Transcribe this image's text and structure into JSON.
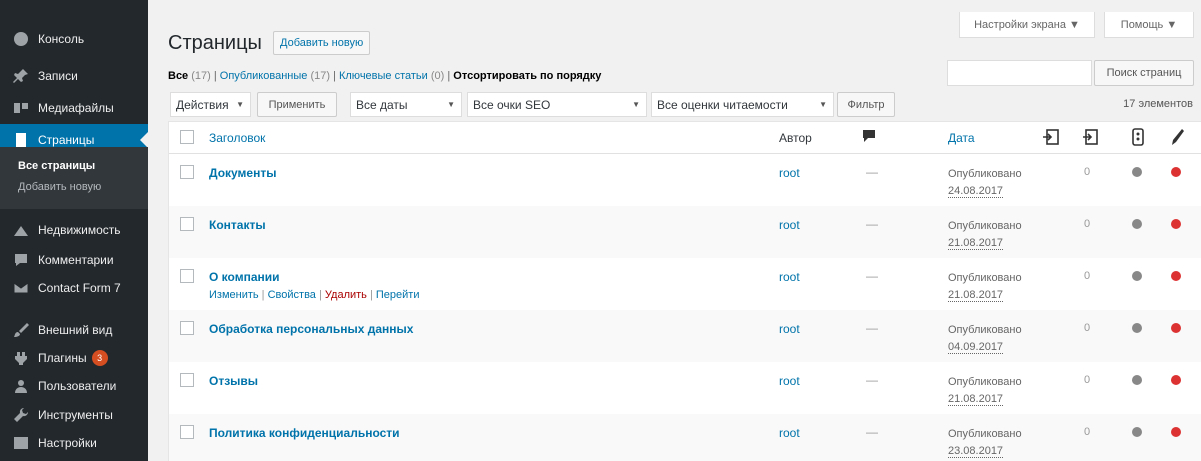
{
  "sidebar": {
    "items": [
      {
        "label": "Консоль",
        "icon": "dashboard-icon"
      },
      {
        "label": "Записи",
        "icon": "pin-icon"
      },
      {
        "label": "Медиафайлы",
        "icon": "media-icon"
      },
      {
        "label": "Страницы",
        "icon": "pages-icon"
      },
      {
        "label": "Недвижимость",
        "icon": "building-icon"
      },
      {
        "label": "Комментарии",
        "icon": "comment-icon"
      },
      {
        "label": "Contact Form 7",
        "icon": "mail-icon"
      },
      {
        "label": "Внешний вид",
        "icon": "brush-icon"
      },
      {
        "label": "Плагины",
        "icon": "plugin-icon",
        "badge": "3"
      },
      {
        "label": "Пользователи",
        "icon": "users-icon"
      },
      {
        "label": "Инструменты",
        "icon": "wrench-icon"
      },
      {
        "label": "Настройки",
        "icon": "settings-icon"
      }
    ],
    "submenu": {
      "all": "Все страницы",
      "add": "Добавить новую"
    }
  },
  "top": {
    "screen_options": "Настройки экрана ▼",
    "help": "Помощь ▼"
  },
  "header": {
    "title": "Страницы",
    "add_new": "Добавить новую"
  },
  "views": {
    "all": "Все",
    "all_count": "(17)",
    "published": "Опубликованные",
    "published_count": "(17)",
    "key": "Ключевые статьи",
    "key_count": "(0)",
    "sort": "Отсортировать по порядку"
  },
  "search": {
    "value": "",
    "button": "Поиск страниц"
  },
  "filters": {
    "bulk": "Действия",
    "apply": "Применить",
    "dates": "Все даты",
    "seo": "Все очки SEO",
    "readability": "Все оценки читаемости",
    "filter": "Фильтр",
    "count": "17 элементов"
  },
  "table": {
    "headers": {
      "title": "Заголовок",
      "author": "Автор",
      "date": "Дата"
    },
    "rows": [
      {
        "title": "Документы",
        "author": "root",
        "comments": "—",
        "status": "Опубликовано",
        "date": "24.08.2017",
        "links": "0"
      },
      {
        "title": "Контакты",
        "author": "root",
        "comments": "—",
        "status": "Опубликовано",
        "date": "21.08.2017",
        "links": "0"
      },
      {
        "title": "О компании",
        "author": "root",
        "comments": "—",
        "status": "Опубликовано",
        "date": "21.08.2017",
        "links": "0",
        "actions": {
          "edit": "Изменить",
          "props": "Свойства",
          "delete": "Удалить",
          "view": "Перейти"
        }
      },
      {
        "title": "Обработка персональных данных",
        "author": "root",
        "comments": "—",
        "status": "Опубликовано",
        "date": "04.09.2017",
        "links": "0"
      },
      {
        "title": "Отзывы",
        "author": "root",
        "comments": "—",
        "status": "Опубликовано",
        "date": "21.08.2017",
        "links": "0"
      },
      {
        "title": "Политика конфиденциальности",
        "author": "root",
        "comments": "—",
        "status": "Опубликовано",
        "date": "23.08.2017",
        "links": "0"
      }
    ]
  },
  "colors": {
    "accent": "#0073aa",
    "sidebar": "#23282d",
    "seo_dot": "#888888",
    "readability_dot": "#dc3232"
  }
}
